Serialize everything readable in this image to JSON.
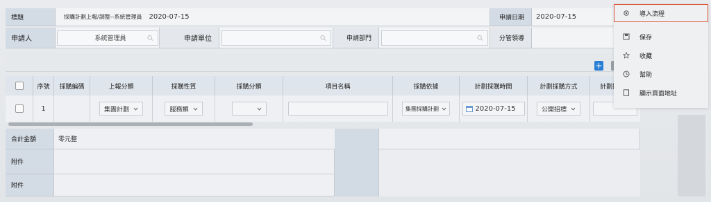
{
  "header": {
    "title_label": "標題",
    "title_value": "採購計劃上報/調整--系統管理員",
    "title_date": "2020-07-15",
    "apply_date_label": "申請日期",
    "apply_date_value": "2020-07-15",
    "applicant_label": "申請人",
    "applicant_value": "系統管理員",
    "unit_label": "申請單位",
    "dept_label": "申請部門",
    "leader_label": "分管領導"
  },
  "menu": {
    "items": [
      {
        "label": "導入流程",
        "icon": "gear-icon"
      },
      {
        "label": "保存",
        "icon": "save-icon"
      },
      {
        "label": "收藏",
        "icon": "star-icon"
      },
      {
        "label": "幫助",
        "icon": "help-icon"
      },
      {
        "label": "顯示頁面地址",
        "icon": "page-icon"
      }
    ]
  },
  "table": {
    "columns": [
      "序號",
      "採購編碼",
      "上報分類",
      "採購性質",
      "採購分類",
      "項目名稱",
      "採購依據",
      "計劃採購時間",
      "計劃採購方式",
      "計劃採"
    ],
    "row": {
      "index": "1",
      "report_category": "集團計劃",
      "nature": "服務類",
      "category": "",
      "basis": "集團採購計劃",
      "plan_date": "2020-07-15",
      "method": "公開招標"
    }
  },
  "summary": {
    "total_label": "合計金額",
    "total_value": "零元整",
    "attach1_label": "附件",
    "attach2_label": "附件"
  },
  "colors": {
    "label_bg": "#d3dbe5",
    "accent_blue": "#2a7fd4",
    "highlight_red": "#e0553a"
  }
}
